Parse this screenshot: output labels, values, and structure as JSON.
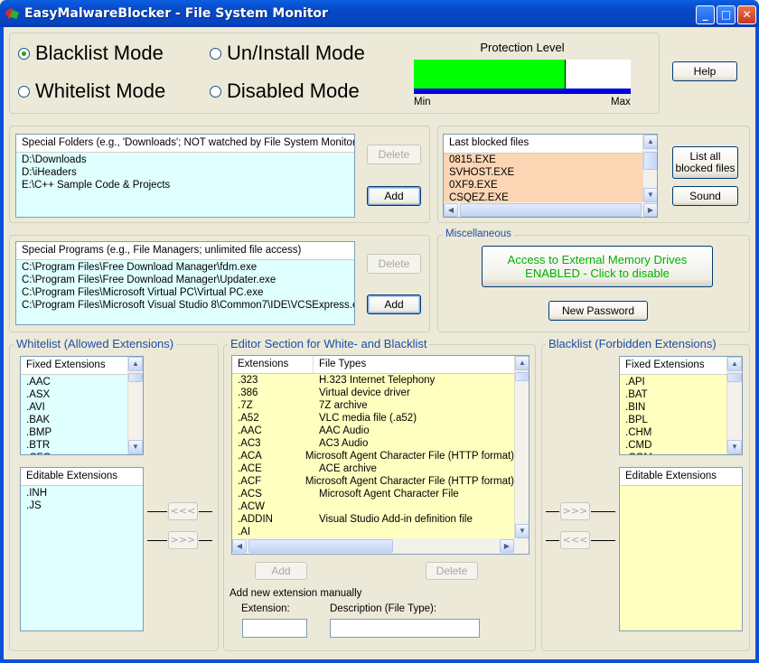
{
  "window": {
    "title": "EasyMalwareBlocker - File System Monitor",
    "minimize": "_",
    "maximize": "□",
    "close": "✕"
  },
  "modes": {
    "blacklist": "Blacklist Mode",
    "uninstall": "Un/Install Mode",
    "whitelist": "Whitelist Mode",
    "disabled": "Disabled Mode",
    "selected": "blacklist"
  },
  "protection": {
    "title": "Protection Level",
    "min": "Min",
    "max": "Max",
    "level": 0.7,
    "fill_color": "#00ff00"
  },
  "help_label": "Help",
  "special_folders": {
    "header": "Special Folders (e.g., 'Downloads'; NOT watched by File System Monitor)",
    "items": [
      "D:\\Downloads",
      "D:\\iHeaders",
      "E:\\C++ Sample Code & Projects"
    ],
    "delete": "Delete",
    "add": "Add"
  },
  "blocked": {
    "header": "Last blocked files",
    "items": [
      "0815.EXE",
      "SVHOST.EXE",
      "0XF9.EXE",
      "CSQEZ.EXE"
    ],
    "list_all": "List all blocked files",
    "sound": "Sound"
  },
  "special_programs": {
    "header": "Special Programs (e.g., File Managers; unlimited file access)",
    "items": [
      "C:\\Program Files\\Free Download Manager\\fdm.exe",
      "C:\\Program Files\\Free Download Manager\\Updater.exe",
      "C:\\Program Files\\Microsoft Virtual PC\\Virtual PC.exe",
      "C:\\Program Files\\Microsoft Visual Studio 8\\Common7\\IDE\\VCSExpress.exe"
    ],
    "delete": "Delete",
    "add": "Add"
  },
  "misc": {
    "title": "Miscellaneous",
    "ext_drives_line1": "Access to External Memory Drives",
    "ext_drives_line2": "ENABLED - Click to disable",
    "new_password": "New Password"
  },
  "whitelist": {
    "title": "Whitelist (Allowed Extensions)",
    "fixed_header": "Fixed Extensions",
    "fixed": [
      ".AAC",
      ".ASX",
      ".AVI",
      ".BAK",
      ".BMP",
      ".BTR",
      ".CFG"
    ],
    "editable_header": "Editable Extensions",
    "editable": [
      ".INH",
      ".JS"
    ],
    "btn_left": "<<<",
    "btn_right": ">>>"
  },
  "editor": {
    "title": "Editor Section for White- and Blacklist",
    "col_ext": "Extensions",
    "col_type": "File Types",
    "rows": [
      [
        ".323",
        "H.323 Internet Telephony"
      ],
      [
        ".386",
        "Virtual device driver"
      ],
      [
        ".7Z",
        "7Z archive"
      ],
      [
        ".A52",
        "VLC media file (.a52)"
      ],
      [
        ".AAC",
        "AAC Audio"
      ],
      [
        ".AC3",
        "AC3 Audio"
      ],
      [
        ".ACA",
        "Microsoft Agent Character File (HTTP format)"
      ],
      [
        ".ACE",
        "ACE archive"
      ],
      [
        ".ACF",
        "Microsoft Agent Character File (HTTP format)"
      ],
      [
        ".ACS",
        "Microsoft Agent Character File"
      ],
      [
        ".ACW",
        ""
      ],
      [
        ".ADDIN",
        "Visual Studio Add-in definition file"
      ],
      [
        ".AI",
        ""
      ]
    ],
    "add": "Add",
    "delete": "Delete",
    "new_ext_label": "Add new extension manually",
    "extension_label": "Extension:",
    "description_label": "Description (File Type):"
  },
  "blacklist": {
    "title": "Blacklist (Forbidden Extensions)",
    "fixed_header": "Fixed Extensions",
    "fixed": [
      ".API",
      ".BAT",
      ".BIN",
      ".BPL",
      ".CHM",
      ".CMD",
      ".COM"
    ],
    "editable_header": "Editable Extensions",
    "editable": [],
    "btn_right": ">>>",
    "btn_left": "<<<"
  }
}
